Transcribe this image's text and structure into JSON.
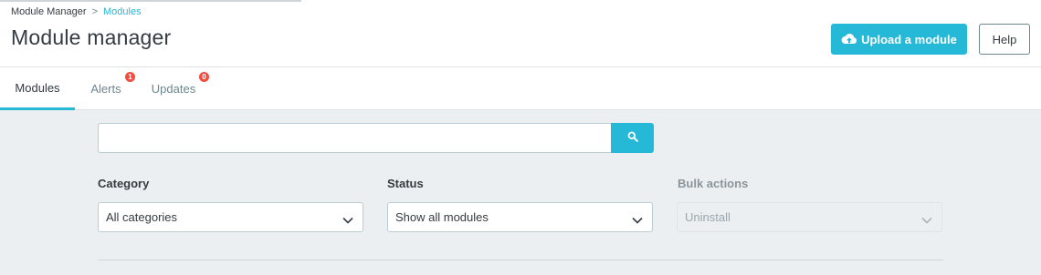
{
  "breadcrumb": {
    "parent": "Module Manager",
    "separator": ">",
    "current": "Modules"
  },
  "page_title": "Module manager",
  "toolbar": {
    "upload_label": "Upload a module",
    "upload_icon": "cloud-upload-icon",
    "help_label": "Help"
  },
  "tabs": [
    {
      "label": "Modules",
      "active": true
    },
    {
      "label": "Alerts",
      "badge": "1"
    },
    {
      "label": "Updates",
      "badge": "0"
    }
  ],
  "search": {
    "value": "",
    "placeholder": "",
    "button_icon": "search-icon"
  },
  "filters": {
    "category": {
      "label": "Category",
      "selected": "All categories"
    },
    "status": {
      "label": "Status",
      "selected": "Show all modules"
    },
    "bulk": {
      "label": "Bulk actions",
      "selected": "Uninstall",
      "disabled": true
    }
  },
  "colors": {
    "accent": "#25b9d7",
    "badge": "#f54c3e",
    "background": "#eceff1"
  }
}
